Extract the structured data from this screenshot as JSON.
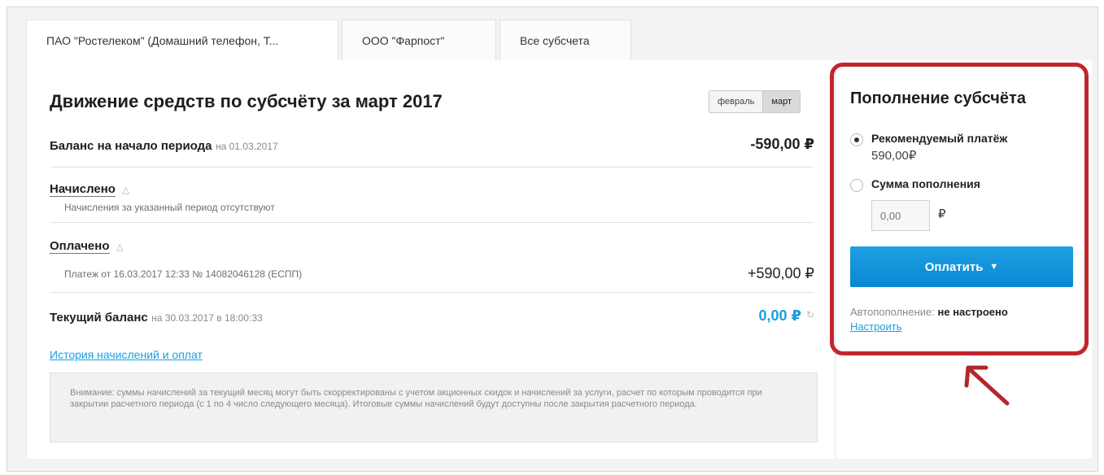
{
  "tabs": [
    {
      "label": "ПАО \"Ростелеком\" (Домашний телефон, Т..."
    },
    {
      "label": "ООО \"Фарпост\""
    },
    {
      "label": "Все субсчета"
    }
  ],
  "main": {
    "title": "Движение средств по субсчёту за март 2017",
    "months": [
      "февраль",
      "март"
    ],
    "selected_month": "март",
    "opening": {
      "label": "Баланс на начало периода",
      "date": "на 01.03.2017",
      "amount": "-590,00 ₽"
    },
    "accrued": {
      "label": "Начислено",
      "note": "Начисления за указанный период отсутствуют"
    },
    "paid": {
      "label": "Оплачено",
      "payment": "Платеж от 16.03.2017 12:33 № 14082046128 (ЕСПП)",
      "amount": "+590,00 ₽"
    },
    "current": {
      "label": "Текущий баланс",
      "date": "на 30.03.2017 в 18:00:33",
      "amount": "0,00 ₽"
    },
    "history_link": "История начислений и оплат",
    "notice": "Внимание: суммы начислений за текущий месяц могут быть скорректированы с учетом акционных скидок и начислений за услуги, расчет по которым проводится при закрытии расчетного периода (с 1 по 4 число следующего месяца). Итоговые суммы начислений будут доступны после закрытия расчетного периода."
  },
  "side": {
    "title": "Пополнение субсчёта",
    "recommended_label": "Рекомендуемый платёж",
    "recommended_value": "590,00₽",
    "custom_label": "Сумма пополнения",
    "input_placeholder": "0,00",
    "currency": "₽",
    "pay_button": "Оплатить",
    "auto_label": "Автопополнение:",
    "auto_status": "не настроено",
    "auto_link": "Настроить"
  },
  "colors": {
    "accent": "#1a9fe0",
    "highlight": "#c3252d"
  },
  "icons": {
    "refresh": "refresh-icon",
    "caret_up": "caret-up-icon",
    "dropdown": "chevron-down-icon",
    "arrow": "pointer-arrow-icon"
  }
}
